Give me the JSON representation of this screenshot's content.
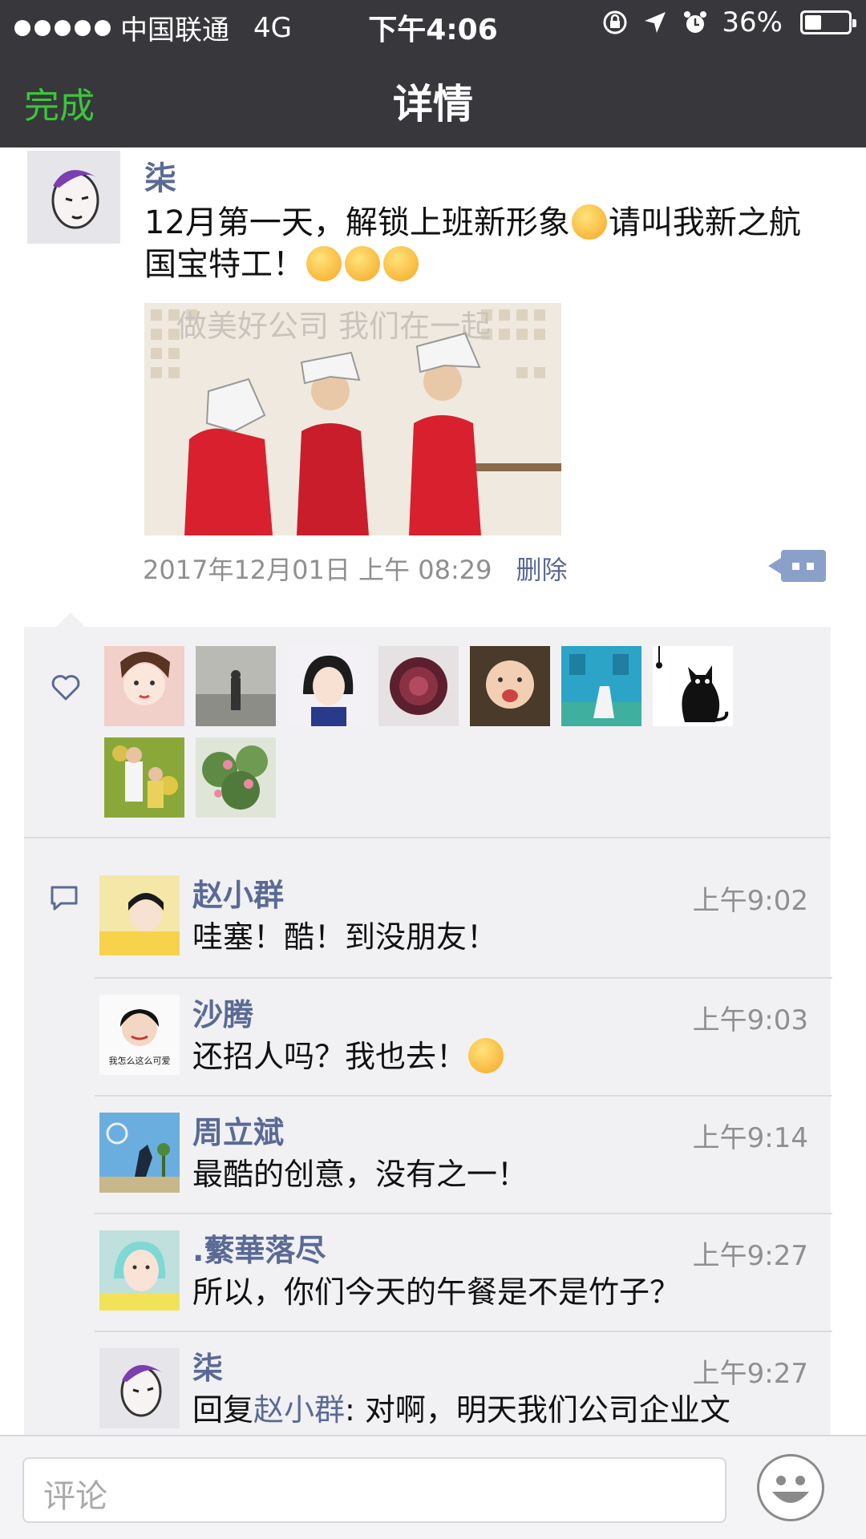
{
  "status_bar": {
    "carrier": "中国联通",
    "network": "4G",
    "time": "下午4:06",
    "battery": "36%",
    "icons": [
      "signal-dots-icon",
      "rotation-lock-icon",
      "location-arrow-icon",
      "alarm-icon",
      "battery-icon"
    ]
  },
  "nav": {
    "done_label": "完成",
    "title": "详情"
  },
  "post": {
    "author": "柒",
    "text_part1": "12月第一天，解锁上班新形象",
    "text_part2": "请叫我新之航",
    "text_part3": "国宝特工！",
    "photo_caption": "做美好公司 我们在一起",
    "timestamp": "2017年12月01日 上午 08:29",
    "delete_label": "删除"
  },
  "likes": {
    "icon": "heart-icon",
    "count": 9
  },
  "comments": [
    {
      "name": "赵小群",
      "time": "上午9:02",
      "text": "哇塞！酷！到没朋友！"
    },
    {
      "name": "沙腾",
      "time": "上午9:03",
      "text": "还招人吗？我也去！",
      "avatar_caption": "我怎么这么可爱"
    },
    {
      "name": "周立斌",
      "time": "上午9:14",
      "text": "最酷的创意，没有之一！"
    },
    {
      "name": ".蘩華落尽",
      "time": "上午9:27",
      "text": "所以，你们今天的午餐是不是竹子？"
    },
    {
      "name": "柒",
      "time": "上午9:27",
      "reply_prefix": "回复",
      "reply_to": "赵小群",
      "text": ": 对啊，明天我们公司企业文"
    }
  ],
  "input": {
    "placeholder": "评论"
  },
  "colors": {
    "nav_bg": "#38383c",
    "done_green": "#3bc63b",
    "name_blue": "#5a6a95",
    "panel_bg": "#f1f1f4"
  }
}
